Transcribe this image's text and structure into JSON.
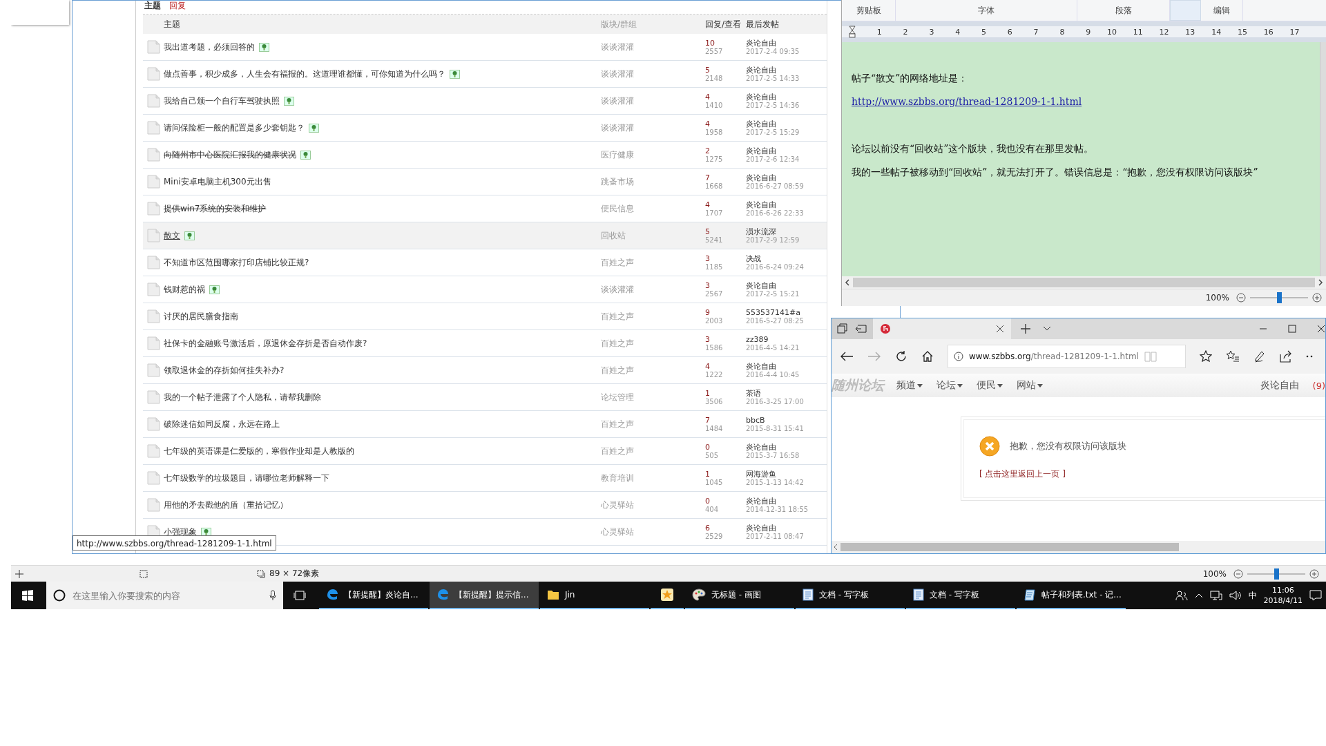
{
  "forum_window": {
    "filter_tabs": [
      {
        "label": "主题",
        "selected": true
      },
      {
        "label": "回复",
        "selected": false
      }
    ],
    "columns": [
      "主题",
      "版块/群组",
      "回复/查看",
      "最后发帖"
    ],
    "rows": [
      {
        "title": "我出道考题，必须回答的",
        "has_image": true,
        "struck": false,
        "hovered": false,
        "forum": "谈谈灌灌",
        "replies": "10",
        "views": "2557",
        "last_poster": "炎论自由",
        "last_time": "2017-2-4 09:35"
      },
      {
        "title": "做点善事，积少成多，人生会有福报的。这道理谁都懂，可你知道为什么吗？",
        "has_image": true,
        "struck": false,
        "hovered": false,
        "forum": "谈谈灌灌",
        "replies": "5",
        "views": "2148",
        "last_poster": "炎论自由",
        "last_time": "2017-2-5 14:33"
      },
      {
        "title": "我给自己颁一个自行车驾驶执照",
        "has_image": true,
        "struck": false,
        "hovered": false,
        "forum": "谈谈灌灌",
        "replies": "4",
        "views": "1410",
        "last_poster": "炎论自由",
        "last_time": "2017-2-5 14:36"
      },
      {
        "title": "请问保险柜一般的配置是多少套钥匙？",
        "has_image": true,
        "struck": false,
        "hovered": false,
        "forum": "谈谈灌灌",
        "replies": "4",
        "views": "1958",
        "last_poster": "炎论自由",
        "last_time": "2017-2-5 15:29"
      },
      {
        "title": "向随州市中心医院汇报我的健康状况",
        "has_image": true,
        "struck": true,
        "hovered": false,
        "forum": "医疗健康",
        "replies": "2",
        "views": "1275",
        "last_poster": "炎论自由",
        "last_time": "2017-2-6 12:34"
      },
      {
        "title": "Mini安卓电脑主机300元出售",
        "has_image": false,
        "struck": false,
        "hovered": false,
        "forum": "跳蚤市场",
        "replies": "7",
        "views": "1668",
        "last_poster": "炎论自由",
        "last_time": "2016-6-27 08:59"
      },
      {
        "title": "提供win7系统的安装和维护",
        "has_image": false,
        "struck": true,
        "hovered": false,
        "forum": "便民信息",
        "replies": "4",
        "views": "1707",
        "last_poster": "炎论自由",
        "last_time": "2016-6-26 22:33"
      },
      {
        "title": "散文",
        "has_image": true,
        "struck": false,
        "hovered": true,
        "forum": "回收站",
        "replies": "5",
        "views": "5241",
        "last_poster": "涢水流深",
        "last_time": "2017-2-9 12:59"
      },
      {
        "title": "不知道市区范围哪家打印店铺比较正规?",
        "has_image": false,
        "struck": false,
        "hovered": false,
        "forum": "百姓之声",
        "replies": "3",
        "views": "1185",
        "last_poster": "决战",
        "last_time": "2016-6-24 09:24"
      },
      {
        "title": "钱财惹的祸",
        "has_image": true,
        "struck": false,
        "hovered": false,
        "forum": "谈谈灌灌",
        "replies": "3",
        "views": "2567",
        "last_poster": "炎论自由",
        "last_time": "2017-2-5 15:21"
      },
      {
        "title": "讨厌的居民膳食指南",
        "has_image": false,
        "struck": false,
        "hovered": false,
        "forum": "百姓之声",
        "replies": "9",
        "views": "2003",
        "last_poster": "553537141#a",
        "last_time": "2016-5-27 08:25"
      },
      {
        "title": "社保卡的金融账号激活后，原退休金存折是否自动作废?",
        "has_image": false,
        "struck": false,
        "hovered": false,
        "forum": "百姓之声",
        "replies": "3",
        "views": "1586",
        "last_poster": "zz389",
        "last_time": "2016-4-5 14:21"
      },
      {
        "title": "领取退休金的存折如何挂失补办?",
        "has_image": false,
        "struck": false,
        "hovered": false,
        "forum": "百姓之声",
        "replies": "4",
        "views": "1222",
        "last_poster": "炎论自由",
        "last_time": "2016-4-4 10:45"
      },
      {
        "title": "我的一个帖子泄露了个人隐私，请帮我删除",
        "has_image": false,
        "struck": false,
        "hovered": false,
        "forum": "论坛管理",
        "replies": "1",
        "views": "3506",
        "last_poster": "茶语",
        "last_time": "2016-3-25 17:00"
      },
      {
        "title": "破除迷信如同反腐，永远在路上",
        "has_image": false,
        "struck": false,
        "hovered": false,
        "forum": "百姓之声",
        "replies": "7",
        "views": "1484",
        "last_poster": "bbcB",
        "last_time": "2015-8-31 15:41"
      },
      {
        "title": "七年级的英语课是仁爱版的，寒假作业却是人教版的",
        "has_image": false,
        "struck": false,
        "hovered": false,
        "forum": "百姓之声",
        "replies": "0",
        "views": "505",
        "last_poster": "炎论自由",
        "last_time": "2015-3-7 16:58"
      },
      {
        "title": "七年级数学的垃圾题目，请哪位老师解释一下",
        "has_image": false,
        "struck": false,
        "hovered": false,
        "forum": "教育培训",
        "replies": "1",
        "views": "1045",
        "last_poster": "网海游鱼",
        "last_time": "2015-1-13 14:42"
      },
      {
        "title": "用他的矛去戳他的盾（重拾记忆）",
        "has_image": false,
        "struck": false,
        "hovered": false,
        "forum": "心灵驿站",
        "replies": "0",
        "views": "404",
        "last_poster": "炎论自由",
        "last_time": "2014-12-31 18:55"
      },
      {
        "title": "小强现象",
        "has_image": true,
        "struck": false,
        "hovered": false,
        "forum": "心灵驿站",
        "replies": "6",
        "views": "2529",
        "last_poster": "炎论自由",
        "last_time": "2017-2-11 08:47"
      }
    ],
    "status_tooltip": "http://www.szbbs.org/thread-1281209-1-1.html"
  },
  "wordpad": {
    "ribbon_groups": [
      "剪贴板",
      "字体",
      "段落",
      "编辑"
    ],
    "ruler_marks": [
      "1",
      "2",
      "3",
      "4",
      "5",
      "6",
      "7",
      "8",
      "9",
      "10",
      "11",
      "12",
      "13",
      "14",
      "15",
      "16",
      "17"
    ],
    "paragraphs": [
      {
        "kind": "text",
        "text": "帖子“散文”的网络地址是："
      },
      {
        "kind": "link",
        "text": "http://www.szbbs.org/thread-1281209-1-1.html"
      },
      {
        "kind": "text",
        "text": "论坛以前没有“回收站”这个版块，我也没有在那里发帖。"
      },
      {
        "kind": "text",
        "text": "我的一些帖子被移动到“回收站”，就无法打开了。错误信息是：“抱歉，您没有权限访问该版块”"
      }
    ],
    "zoom": {
      "reading": "100%",
      "level": 0.5
    }
  },
  "edge": {
    "url_host": "www.szbbs.org",
    "url_path": "/thread-1281209-1-1.html",
    "site_nav": {
      "logo": "随州论坛",
      "menus": [
        "频道",
        "论坛",
        "便民",
        "网站"
      ],
      "user": "炎论自由",
      "notice_count": "(9)"
    },
    "error": {
      "message": "抱歉，您没有权限访问该版块",
      "back_link": "[ 点击这里返回上一页 ]"
    }
  },
  "paint_status": {
    "size": "89 × 72像素",
    "zoom": {
      "reading": "100%",
      "level": 0.5
    }
  },
  "taskbar": {
    "search_placeholder": "在这里输入你要搜索的内容",
    "items": [
      {
        "kind": "edge",
        "label": "【新提醒】炎论自...",
        "active": false
      },
      {
        "kind": "edge",
        "label": "【新提醒】提示信...",
        "active": true
      },
      {
        "kind": "folder",
        "label": "Jin",
        "active": false
      },
      {
        "kind": "app",
        "active": false
      },
      {
        "kind": "paint",
        "label": "无标题 - 画图",
        "active": false
      },
      {
        "kind": "wordpad",
        "label": "文档 - 写字板",
        "active": false
      },
      {
        "kind": "wordpad",
        "label": "文档 - 写字板",
        "active": false
      },
      {
        "kind": "notepad",
        "label": "帖子和列表.txt - 记...",
        "active": false
      }
    ],
    "ime": "中",
    "time": "11:06",
    "date": "2018/4/11"
  }
}
